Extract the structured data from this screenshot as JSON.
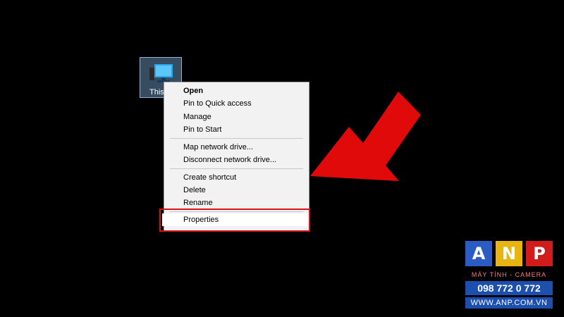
{
  "desktop": {
    "icon_label": "This"
  },
  "context_menu": {
    "items": [
      {
        "label": "Open"
      },
      {
        "label": "Pin to Quick access"
      },
      {
        "label": "Manage"
      },
      {
        "label": "Pin to Start"
      },
      {
        "label": "Map network drive..."
      },
      {
        "label": "Disconnect network drive..."
      },
      {
        "label": "Create shortcut"
      },
      {
        "label": "Delete"
      },
      {
        "label": "Rename"
      },
      {
        "label": "Properties"
      }
    ]
  },
  "annotation": {
    "highlight_color": "#d8131b",
    "arrow_color": "#e10a0a"
  },
  "watermark": {
    "letters": [
      "A",
      "N",
      "P"
    ],
    "tile_colors": [
      "#2a5cc4",
      "#e8b412",
      "#d21b1b"
    ],
    "tagline": "MÁY TÍNH - CAMERA",
    "phone": "098 772 0 772",
    "website": "WWW.ANP.COM.VN"
  }
}
